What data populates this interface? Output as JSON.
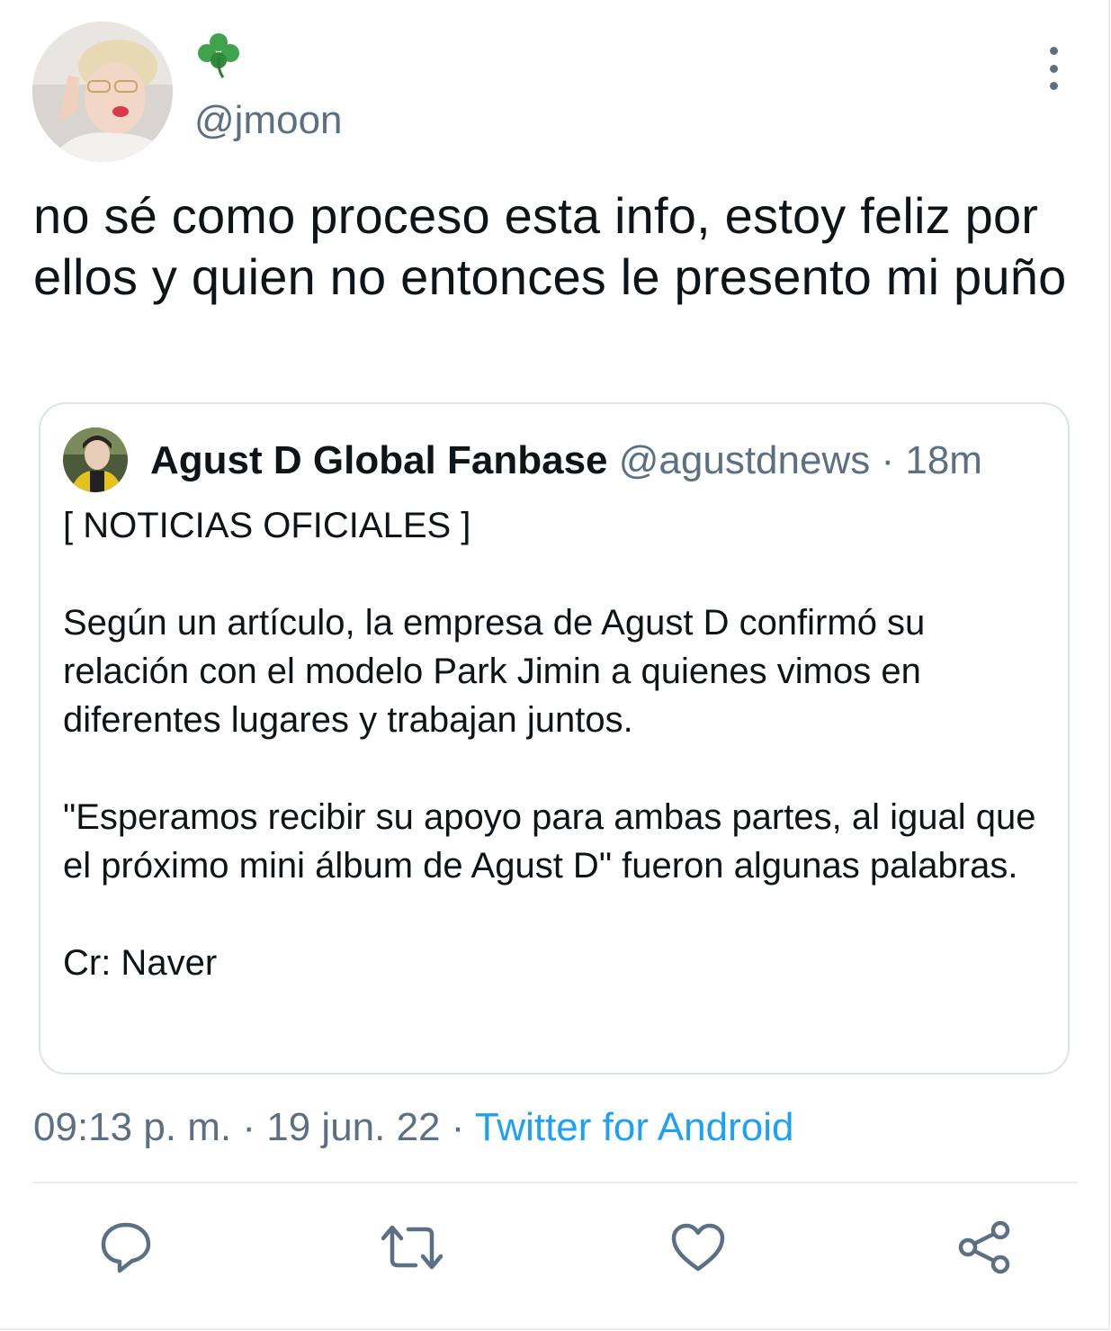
{
  "tweet": {
    "display_name_emoji": "🍀",
    "handle": "@jmoon",
    "text": "no sé como proceso esta info, estoy feliz por ellos y quien no entonces le presento mi puño"
  },
  "quote": {
    "name": "Agust D Global Fanbase",
    "handle": "@agustdnews",
    "separator": " · ",
    "time": "18m",
    "paragraphs": [
      "[ NOTICIAS OFICIALES ]",
      "Según un artículo, la empresa de Agust D confirmó su relación con el modelo Park Jimin a quienes vimos en diferentes lugares y trabajan juntos.",
      "\"Esperamos recibir su apoyo para ambas partes, al igual que el próximo mini álbum de Agust D\" fueron algunas palabras.",
      "Cr: Naver"
    ]
  },
  "meta": {
    "time": "09:13 p. m.",
    "sep1": " · ",
    "date": "19 jun. 22",
    "sep2": " · ",
    "source": "Twitter for Android"
  },
  "colors": {
    "text": "#0f1419",
    "secondary": "#5b7083",
    "link": "#1da1f2",
    "border": "#dbe4ea"
  },
  "actions": [
    "reply-icon",
    "retweet-icon",
    "like-icon",
    "share-icon"
  ]
}
